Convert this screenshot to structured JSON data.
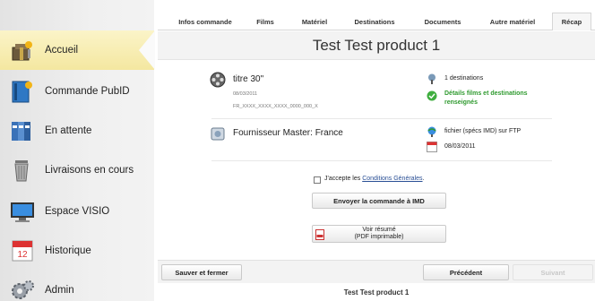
{
  "sidebar": {
    "items": [
      {
        "label": "Accueil",
        "icon": "home-gift-icon"
      },
      {
        "label": "Commande PubID",
        "icon": "order-book-icon"
      },
      {
        "label": "En attente",
        "icon": "folder-binders-icon"
      },
      {
        "label": "Livraisons en cours",
        "icon": "trash-bin-icon"
      },
      {
        "label": "Espace VISIO",
        "icon": "monitor-icon"
      },
      {
        "label": "Historique",
        "icon": "calendar-icon"
      },
      {
        "label": "Admin",
        "icon": "gears-icon"
      }
    ]
  },
  "tabs": [
    "Infos commande",
    "Films",
    "Matériel",
    "Destinations",
    "Documents",
    "Autre matériel",
    "Récap"
  ],
  "page": {
    "title": "Test Test product 1",
    "footer_title": "Test Test product 1"
  },
  "film": {
    "title": "titre 30\"",
    "date": "08/03/2011",
    "code": "FR_XXXX_XXXX_XXXX_0000_000_X"
  },
  "destinations": {
    "count_text": "1 destinations",
    "details_text": "Détails films et destinations renseignés"
  },
  "supplier": {
    "label": "Fournisseur Master: France"
  },
  "delivery": {
    "method_text": "fichier (spécs IMD) sur FTP",
    "date": "08/03/2011"
  },
  "terms": {
    "prefix": "J'accepte les ",
    "link_text": "Conditions Générales",
    "suffix": "."
  },
  "buttons": {
    "send": "Envoyer la commande à IMD",
    "summary_line1": "Voir résumé",
    "summary_line2": "(PDF imprimable)",
    "save_close": "Sauver et fermer",
    "previous": "Précédent",
    "next": "Suivant"
  },
  "colors": {
    "accent_green": "#2f9a2f",
    "link_blue": "#2a4f95",
    "active_tab_bg": "#f6f6f6"
  }
}
